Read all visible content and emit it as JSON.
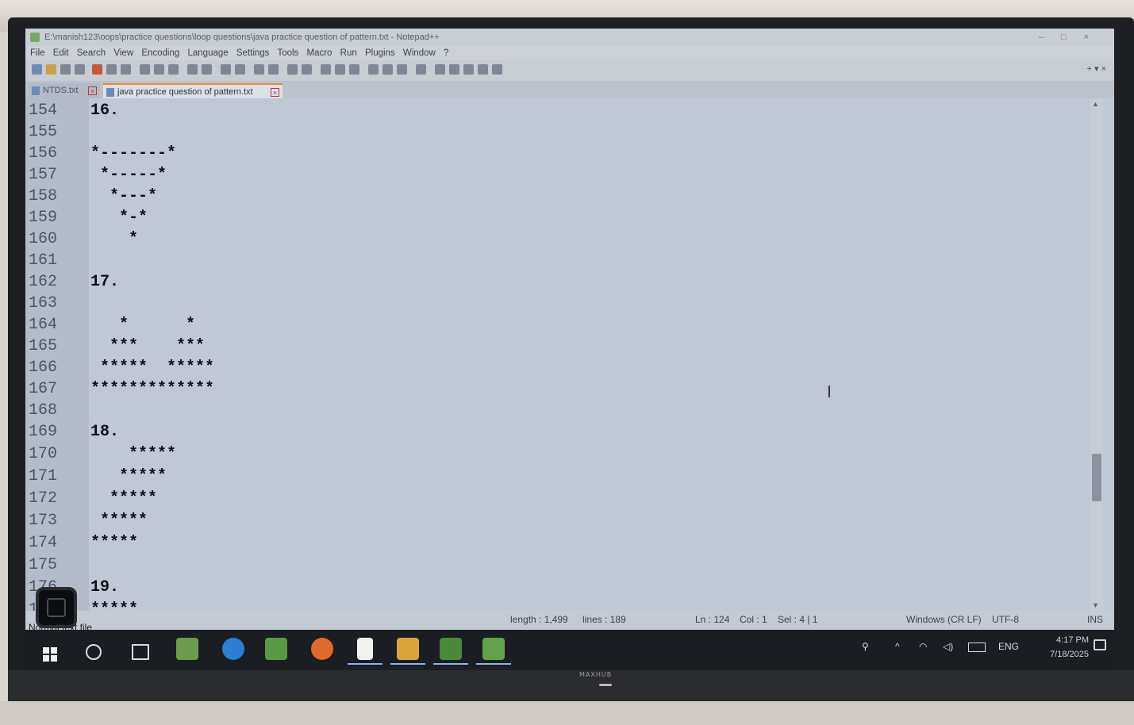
{
  "window": {
    "title": "E:\\manish123\\oops\\practice questions\\loop questions\\java practice question of pattern.txt - Notepad++"
  },
  "menu": [
    "File",
    "Edit",
    "Search",
    "View",
    "Encoding",
    "Language",
    "Settings",
    "Tools",
    "Macro",
    "Run",
    "Plugins",
    "Window",
    "?"
  ],
  "tabs": [
    {
      "label": "NTDS.txt"
    },
    {
      "label": "java practice question of pattern.txt"
    }
  ],
  "editor": {
    "lines": [
      {
        "n": "154",
        "t": "16."
      },
      {
        "n": "155",
        "t": ""
      },
      {
        "n": "156",
        "t": "*-------*"
      },
      {
        "n": "157",
        "t": " *-----*"
      },
      {
        "n": "158",
        "t": "  *---*"
      },
      {
        "n": "159",
        "t": "   *-*"
      },
      {
        "n": "160",
        "t": "    *"
      },
      {
        "n": "161",
        "t": ""
      },
      {
        "n": "162",
        "t": "17."
      },
      {
        "n": "163",
        "t": ""
      },
      {
        "n": "164",
        "t": "   *      *"
      },
      {
        "n": "165",
        "t": "  ***    ***"
      },
      {
        "n": "166",
        "t": " *****  *****"
      },
      {
        "n": "167",
        "t": "*************"
      },
      {
        "n": "168",
        "t": ""
      },
      {
        "n": "169",
        "t": "18."
      },
      {
        "n": "170",
        "t": "    *****"
      },
      {
        "n": "171",
        "t": "   *****"
      },
      {
        "n": "172",
        "t": "  *****"
      },
      {
        "n": "173",
        "t": " *****"
      },
      {
        "n": "174",
        "t": "*****"
      },
      {
        "n": "175",
        "t": ""
      },
      {
        "n": "176",
        "t": "19."
      },
      {
        "n": "177",
        "t": "*****"
      }
    ]
  },
  "status": {
    "length": "length : 1,499",
    "lines": "lines : 189",
    "ln": "Ln : 124",
    "col": "Col : 1",
    "sel": "Sel : 4 | 1",
    "eol": "Windows (CR LF)",
    "encoding": "UTF-8",
    "mode": "INS"
  },
  "file_type": "Normal text file",
  "tray": {
    "lang": "ENG",
    "time": "4:17 PM",
    "date": "7/18/2025"
  },
  "monitor": {
    "brand": "MAXHUB"
  },
  "colors": {
    "accent": "#e88a3a",
    "taskbar": "#1a1d22"
  }
}
